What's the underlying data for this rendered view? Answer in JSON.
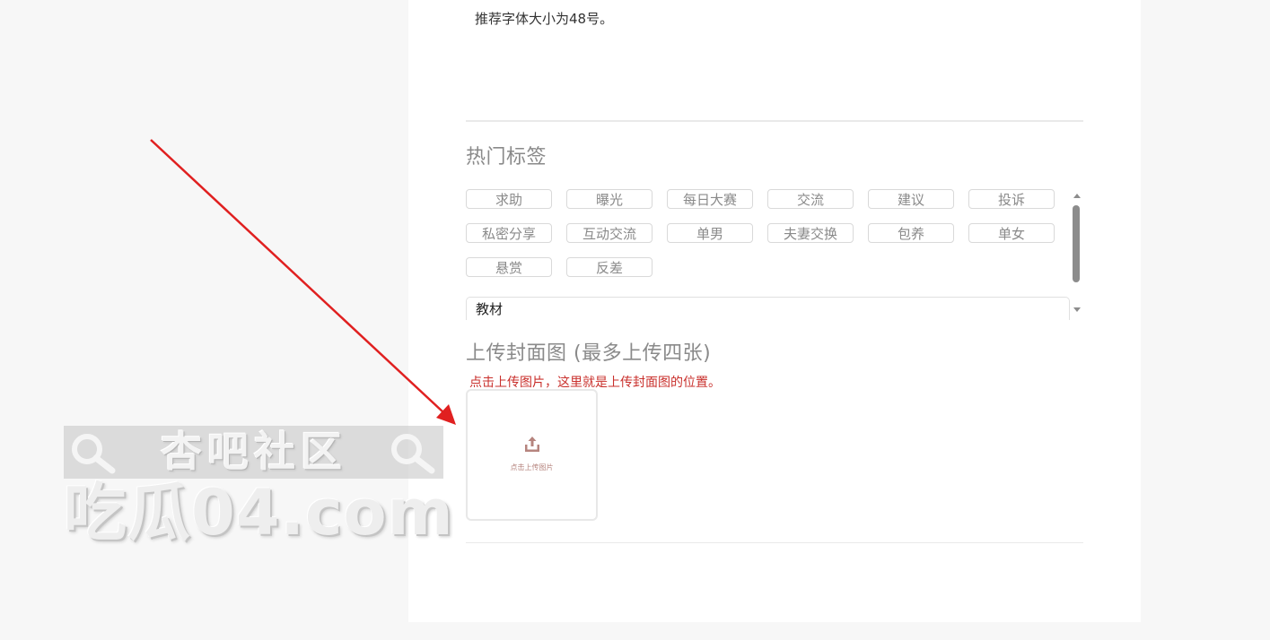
{
  "page": {
    "font_size_hint": "推荐字体大小为48号。"
  },
  "hot_tags": {
    "title": "热门标签",
    "tags": [
      "求助",
      "曝光",
      "每日大赛",
      "交流",
      "建议",
      "投诉",
      "私密分享",
      "互动交流",
      "单男",
      "夫妻交换",
      "包养",
      "单女",
      "悬赏",
      "反差"
    ],
    "input_value": "教材"
  },
  "cover_upload": {
    "title": "上传封面图 (最多上传四张)",
    "note": "点击上传图片，这里就是上传封面图的位置。",
    "box_label": "点击上传图片",
    "icon": "upload-icon"
  },
  "annotation": {
    "arrow_color": "#e02020"
  },
  "watermark": {
    "site_name": "杏吧社区",
    "domain": "吃瓜04.com",
    "icon": "magnifier-icon"
  },
  "colors": {
    "background": "#f7f7f7",
    "card": "#ffffff",
    "muted_text": "#8a8a8a",
    "note_red": "#c9302c",
    "upload_accent": "#b6847e"
  }
}
